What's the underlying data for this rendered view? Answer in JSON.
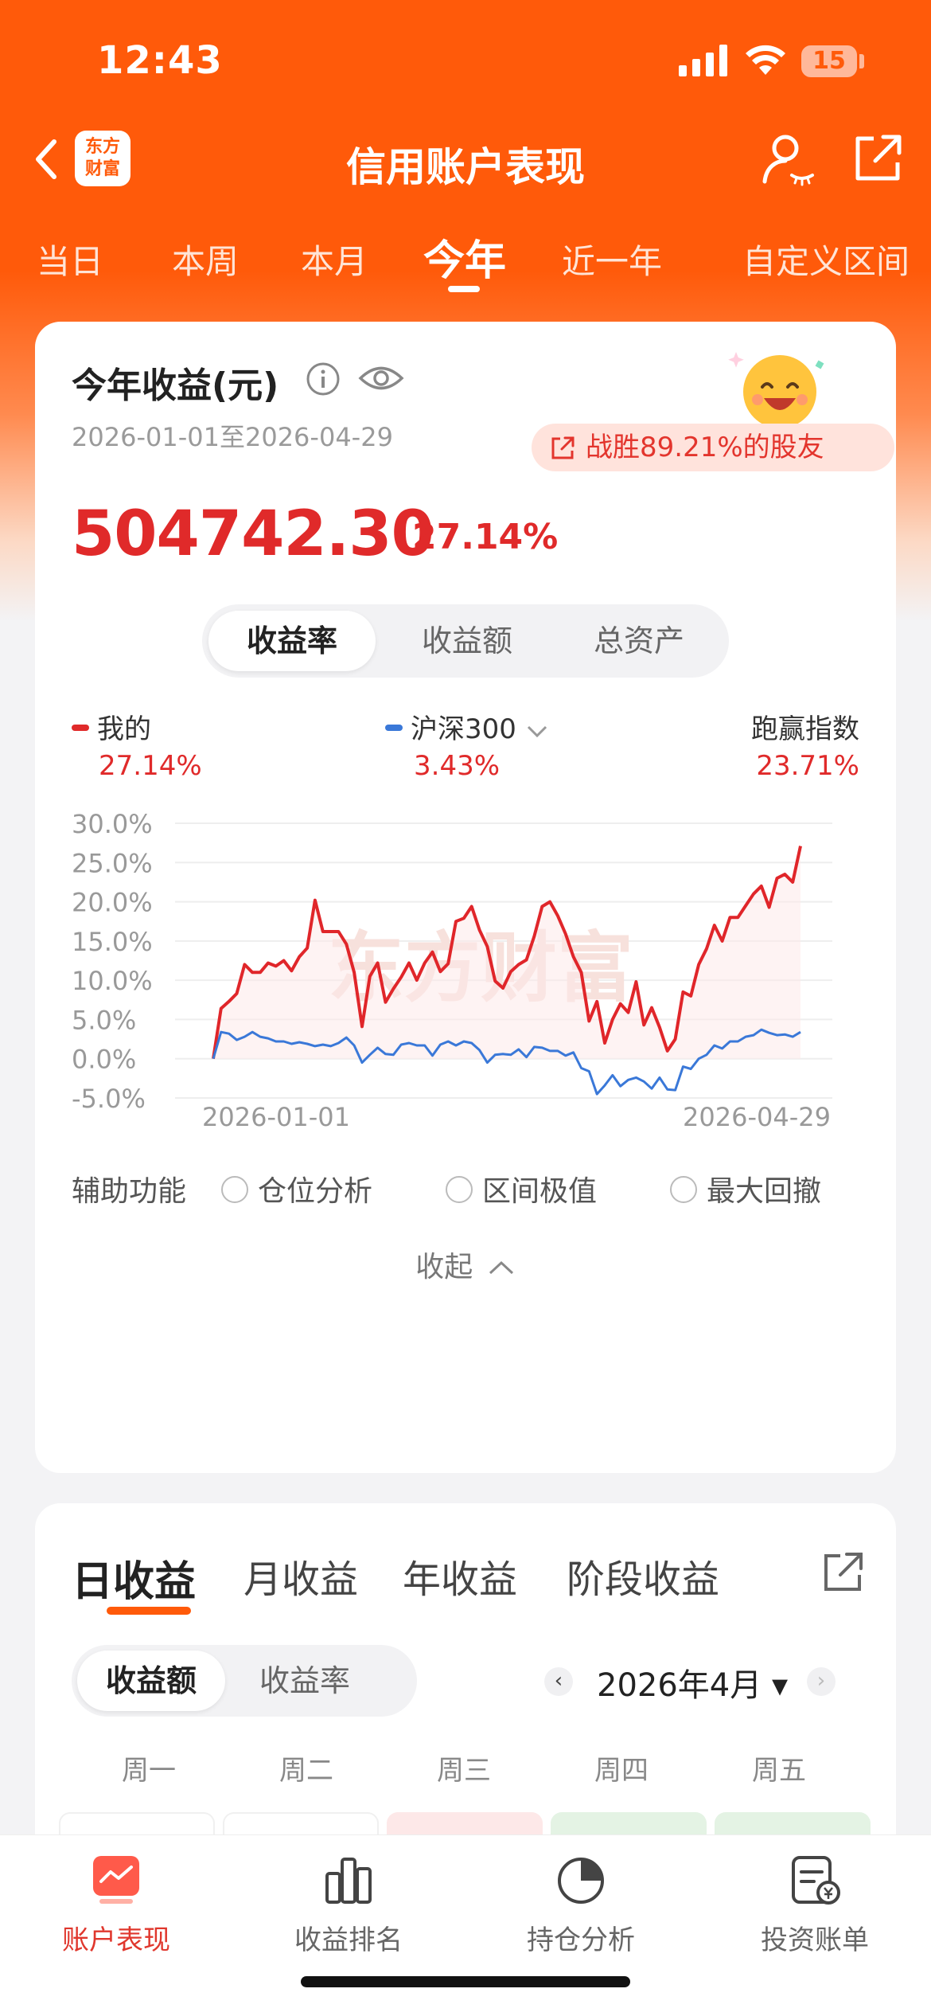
{
  "status_bar": {
    "time": "12:43",
    "battery": "15"
  },
  "nav": {
    "logo_line1": "东方",
    "logo_line2": "财富",
    "title": "信用账户表现"
  },
  "period_tabs": [
    {
      "label": "当日"
    },
    {
      "label": "本周"
    },
    {
      "label": "本月"
    },
    {
      "label": "今年",
      "active": true
    },
    {
      "label": "近一年"
    },
    {
      "label": "自定义区间"
    }
  ],
  "summary": {
    "title": "今年收益(元)",
    "date_range": "2026-01-01至2026-04-29",
    "rank_text": "战胜89.21%的股友",
    "amount": "504742.30",
    "percent": "27.14%"
  },
  "chart_tabs": {
    "yield_rate": "收益率",
    "yield_amount": "收益额",
    "total_assets": "总资产"
  },
  "legend": {
    "mine_label": "我的",
    "mine_value": "27.14%",
    "index_label": "沪深300",
    "index_value": "3.43%",
    "beat_label": "跑赢指数",
    "beat_value": "23.71%"
  },
  "chart_data": {
    "type": "line",
    "x_start_label": "2026-01-01",
    "x_end_label": "2026-04-29",
    "ylim": [
      -5,
      30
    ],
    "yticks": [
      "30.0%",
      "25.0%",
      "20.0%",
      "15.0%",
      "10.0%",
      "5.0%",
      "0.0%",
      "-5.0%"
    ],
    "series": [
      {
        "name": "我的",
        "color": "#e0262a",
        "values": [
          0,
          6.4,
          7.3,
          8.3,
          12.0,
          11.0,
          11.0,
          12.2,
          11.8,
          12.5,
          11.2,
          13.0,
          14.1,
          20.2,
          16.2,
          16.2,
          16.2,
          14.6,
          11.0,
          4.1,
          10.5,
          12.2,
          7.2,
          8.9,
          10.4,
          12.2,
          10.0,
          12.2,
          13.6,
          11.1,
          12.1,
          17.5,
          17.9,
          19.4,
          16.4,
          14.3,
          9.9,
          9.0,
          11.1,
          12.0,
          12.6,
          15.6,
          19.4,
          20.0,
          18.2,
          15.9,
          13.0,
          11.0,
          4.8,
          7.3,
          2.0,
          5.0,
          7.0,
          5.9,
          9.8,
          4.3,
          6.5,
          4.0,
          1.0,
          2.5,
          8.5,
          8.0,
          12.0,
          14.0,
          17.0,
          15.0,
          18.0,
          18.0,
          19.5,
          21.0,
          22.0,
          19.3,
          23.0,
          23.5,
          22.5,
          27.1
        ]
      },
      {
        "name": "沪深300",
        "color": "#3a78d8",
        "values": [
          0,
          3.4,
          3.2,
          2.4,
          2.8,
          3.4,
          2.8,
          2.6,
          2.2,
          2.2,
          1.9,
          2.1,
          1.9,
          1.6,
          1.8,
          1.6,
          2.0,
          2.7,
          1.7,
          -0.5,
          0.5,
          1.4,
          0.6,
          0.5,
          1.8,
          2.0,
          1.7,
          1.7,
          0.4,
          1.8,
          2.2,
          1.7,
          2.2,
          2.0,
          1.1,
          -0.5,
          0.5,
          0.6,
          0.5,
          1.2,
          0.2,
          1.5,
          1.4,
          1.0,
          1.0,
          0.4,
          0.8,
          -1.2,
          -1.6,
          -4.5,
          -3.4,
          -2.1,
          -3.5,
          -2.7,
          -2.4,
          -2.9,
          -3.8,
          -2.4,
          -3.9,
          -4.0,
          -1.0,
          -1.3,
          0.0,
          0.5,
          1.7,
          1.3,
          2.2,
          2.2,
          2.8,
          3.0,
          3.7,
          3.3,
          3.0,
          3.1,
          2.8,
          3.4
        ]
      }
    ]
  },
  "aux": {
    "label": "辅助功能",
    "opt1": "仓位分析",
    "opt2": "区间极值",
    "opt3": "最大回撤"
  },
  "collapse_label": "收起",
  "income_tabs": {
    "daily": "日收益",
    "monthly": "月收益",
    "yearly": "年收益",
    "stage": "阶段收益"
  },
  "income_toggle": {
    "amount": "收益额",
    "rate": "收益率"
  },
  "month": "2026年4月",
  "weekdays": [
    "周一",
    "周二",
    "周三",
    "周四",
    "周五"
  ],
  "bottom_nav": [
    {
      "label": "账户表现",
      "active": true
    },
    {
      "label": "收益排名"
    },
    {
      "label": "持仓分析"
    },
    {
      "label": "投资账单"
    }
  ],
  "colors": {
    "brand": "#ff5a0a",
    "gain": "#e02a2a",
    "index": "#3a78d8"
  }
}
